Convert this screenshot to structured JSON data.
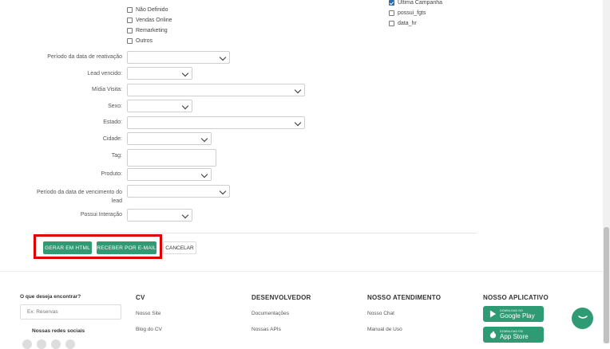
{
  "checkboxes_left": [
    {
      "label": "Não Definido",
      "checked": false
    },
    {
      "label": "Vendas Online",
      "checked": false
    },
    {
      "label": "Remarketing",
      "checked": false
    },
    {
      "label": "Outros",
      "checked": false
    }
  ],
  "checkboxes_right": [
    {
      "label": "Ultima Campanha",
      "checked": true
    },
    {
      "label": "possui_fgts",
      "checked": false
    },
    {
      "label": "data_hr",
      "checked": false
    }
  ],
  "fields": {
    "periodo_reativacao": "Período da data de reativação",
    "lead_vencido": "Lead vencido:",
    "midia_visita": "Mídia Visita:",
    "sexo": "Sexo:",
    "estado": "Estado:",
    "cidade": "Cidade:",
    "tag": "Tag:",
    "produto": "Produto:",
    "periodo_vencimento_1": "Período da data de vencimento do",
    "periodo_vencimento_2": "lead",
    "possui_interacao": "Possui Interação"
  },
  "actions": {
    "gerar_html": "GERAR EM HTML",
    "receber_email": "RECEBER POR E-MAIL",
    "cancelar": "CANCELAR"
  },
  "footer": {
    "search_title": "O que deseja encontrar?",
    "search_placeholder": "Ex: Reservas",
    "social_title": "Nossas redes sociais",
    "cv_title": "CV",
    "cv_links": [
      "Nosso Site",
      "Blog do CV"
    ],
    "dev_title": "DESENVOLVEDOR",
    "dev_links": [
      "Documentações",
      "Nossas APIs"
    ],
    "atendimento_title": "NOSSO ATENDIMENTO",
    "atendimento_links": [
      "Nosso Chat",
      "Manual de Uso"
    ],
    "app_title": "NOSSO APLICATIVO",
    "google_small": "DOWNLOAD NO",
    "google_big": "Google Play",
    "apple_small": "DOWNLOAD EM",
    "apple_big": "App Store"
  },
  "colors": {
    "accent": "#2e9b74",
    "highlight": "#e00000",
    "checkbox": "#2b6cb0"
  }
}
